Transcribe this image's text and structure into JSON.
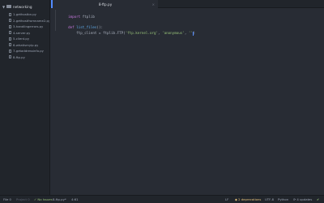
{
  "sidebar": {
    "root": {
      "label": "networking"
    },
    "files": [
      {
        "label": "1-gethostbn.py"
      },
      {
        "label": "2-gethostfromname2.py"
      },
      {
        "label": "3-handlingerrors.py"
      },
      {
        "label": "4-server.py"
      },
      {
        "label": "5-client.py"
      },
      {
        "label": "6-whatismyip.py"
      },
      {
        "label": "7-getaddressinfo.py"
      },
      {
        "label": "8-ftp.py"
      }
    ]
  },
  "tabs": [
    {
      "label": "8-ftp.py",
      "close": "×"
    }
  ],
  "editor": {
    "l1_kw": "import",
    "l1_rest": " ftplib",
    "l2_kw": "def",
    "l2_sp": " ",
    "l2_fn": "list_files",
    "l2_rest": "():",
    "l3_pre": "    ftp_client = ftplib.FTP(",
    "l3_s1": "'ftp.kernel.org'",
    "l3_comma": ", ",
    "l3_s2": "'anonymous'",
    "l3_comma2": ", ",
    "l3_s3": "''",
    "l3_end": ")"
  },
  "status": {
    "file": "File 0",
    "project": "Project 0",
    "issues": "✓ No Issues",
    "filename": "8-ftp.py*",
    "cursor": "4:61",
    "encoding": "LF",
    "deprecations": "◆ 2 deprecations",
    "charset": "UTF-8",
    "grammar": "Python",
    "git": "⟳ 4 updates",
    "github": "✔"
  },
  "colors": {
    "accent": "#528bff",
    "background": "#282c34",
    "sidebar": "#21252b",
    "keyword": "#c678dd",
    "function": "#61afef",
    "string": "#98c379"
  }
}
